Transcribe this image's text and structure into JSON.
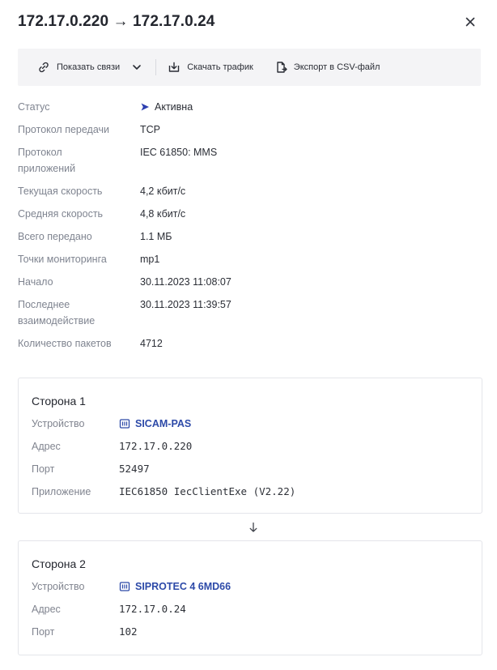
{
  "header": {
    "title": "172.17.0.220 → 172.17.0.24",
    "close_icon": "close-icon"
  },
  "toolbar": {
    "show_links": "Показать связи",
    "download_traffic": "Скачать трафик",
    "export_csv": "Экспорт в CSV-файл"
  },
  "props": [
    {
      "key": "Статус",
      "value": "Активна"
    },
    {
      "key": "Протокол передачи",
      "value": "TCP"
    },
    {
      "key": "Протокол приложений",
      "value": "IEC 61850: MMS"
    },
    {
      "key": "Текущая скорость",
      "value": "4,2 кбит/с"
    },
    {
      "key": "Средняя скорость",
      "value": "4,8 кбит/с"
    },
    {
      "key": "Всего передано",
      "value": "1.1 МБ"
    },
    {
      "key": "Точки мониторинга",
      "value": "mp1"
    },
    {
      "key": "Начало",
      "value": "30.11.2023 11:08:07"
    },
    {
      "key": "Последнее взаимодействие",
      "value": "30.11.2023 11:39:57"
    },
    {
      "key": "Количество пакетов",
      "value": "4712"
    }
  ],
  "colors": {
    "accent": "#2d4aa8",
    "status_active": "#2d3fb0"
  },
  "side1": {
    "title": "Сторона 1",
    "device_label": "Устройство",
    "device": "SICAM-PAS",
    "address_label": "Адрес",
    "address": "172.17.0.220",
    "port_label": "Порт",
    "port": "52497",
    "app_label": "Приложение",
    "app": "IEC61850 IecClientExe (V2.22)"
  },
  "side2": {
    "title": "Сторона 2",
    "device_label": "Устройство",
    "device": "SIPROTEC 4 6MD66",
    "address_label": "Адрес",
    "address": "172.17.0.24",
    "port_label": "Порт",
    "port": "102"
  }
}
